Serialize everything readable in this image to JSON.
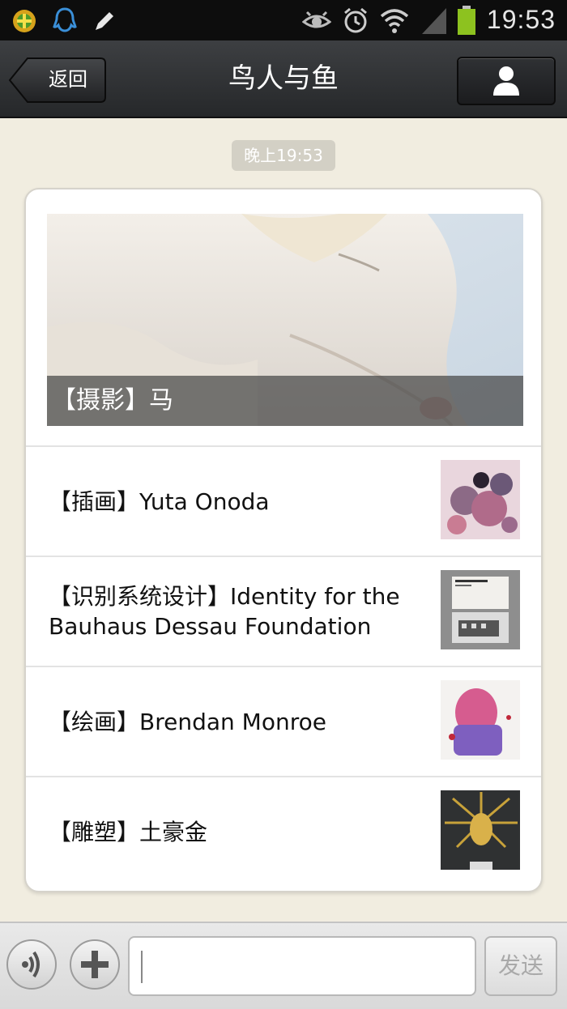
{
  "status_bar": {
    "time": "19:53",
    "icons": [
      "app-notification-icon",
      "qq-icon",
      "pencil-icon",
      "eye-icon",
      "alarm-icon",
      "wifi-icon",
      "signal-icon",
      "battery-icon"
    ],
    "battery_color": "#8dc21f"
  },
  "header": {
    "back_label": "返回",
    "title": "鸟人与鱼"
  },
  "timestamp": "晚上19:53",
  "card": {
    "hero_caption": "【摄影】马",
    "articles": [
      {
        "title": "【插画】Yuta Onoda"
      },
      {
        "title": "【识别系统设计】Identity for the Bauhaus Dessau Foundation"
      },
      {
        "title": "【绘画】Brendan Monroe"
      },
      {
        "title": "【雕塑】土豪金"
      }
    ]
  },
  "input_bar": {
    "message_value": "",
    "send_label": "发送"
  }
}
